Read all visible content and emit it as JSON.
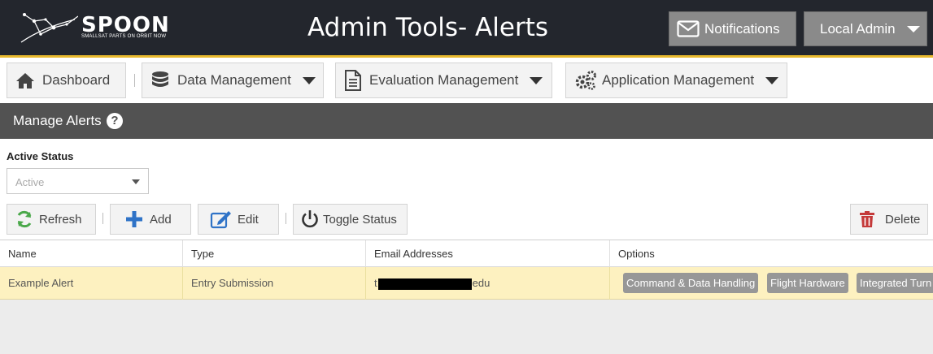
{
  "header": {
    "logo_word": "SPOON",
    "logo_tagline": "SMALLSAT PARTS ON ORBIT NOW",
    "title": "Admin Tools- Alerts",
    "notifications_label": "Notifications",
    "user_label": "Local Admin"
  },
  "nav": {
    "items": [
      {
        "label": "Dashboard",
        "icon": "home-icon"
      },
      {
        "label": "Data Management",
        "icon": "database-icon"
      },
      {
        "label": "Evaluation Management",
        "icon": "document-icon"
      },
      {
        "label": "Application Management",
        "icon": "gears-icon"
      }
    ]
  },
  "section": {
    "title": "Manage Alerts",
    "help": "?"
  },
  "filter": {
    "label": "Active Status",
    "value": "Active"
  },
  "toolbar": {
    "refresh": "Refresh",
    "add": "Add",
    "edit": "Edit",
    "toggle": "Toggle Status",
    "delete": "Delete"
  },
  "grid": {
    "columns": [
      "Name",
      "Type",
      "Email Addresses",
      "Options"
    ],
    "rows": [
      {
        "name": "Example Alert",
        "type": "Entry Submission",
        "email_prefix": "t",
        "email_suffix": "edu",
        "options": [
          "Command & Data Handling",
          "Flight Hardware",
          "Integrated Turn"
        ]
      }
    ]
  },
  "colors": {
    "header_bg": "#23262d",
    "accent": "#e8b92d",
    "section_bg": "#525252",
    "selected_row": "#fdf1c0",
    "tag_bg": "#979797"
  }
}
